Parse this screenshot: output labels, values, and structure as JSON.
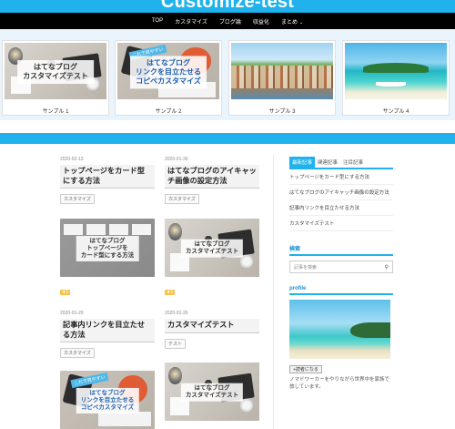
{
  "site": {
    "title": "Customize-test"
  },
  "nav": {
    "items": [
      "TOP",
      "カスタマイズ",
      "ブログ論",
      "収益化",
      "まとめ"
    ],
    "dropdown_caret": "⌄"
  },
  "carousel": {
    "slides": [
      {
        "caption": "サンプル 1",
        "overlay": [
          "はてなブログ",
          "カスタマイズテスト"
        ],
        "theme": "desk"
      },
      {
        "caption": "サンプル 2",
        "overlay": [
          "はてなブログ",
          "リンクを目立たせる",
          "コピペカスタマイズ"
        ],
        "theme": "desk2"
      },
      {
        "caption": "サンプル 3",
        "theme": "town"
      },
      {
        "caption": "サンプル 4",
        "theme": "beach"
      }
    ]
  },
  "posts": [
    {
      "date": "2020-02-13",
      "title": "トップページをカード型にする方法",
      "tag": "カスタマイズ",
      "thumb_text": [
        "はてなブログ",
        "トップページを",
        "カード型にする方法"
      ]
    },
    {
      "date": "2020-01-30",
      "title": "はてなブログのアイキャッチ画像の設定方法",
      "tag": "カスタマイズ",
      "thumb_text": [
        "はてなブログ",
        "カスタマイズテスト"
      ]
    },
    {
      "date": "2020-01-29",
      "title": "記事内リンクを目立たせる方法",
      "tag": "カスタマイズ",
      "thumb_text": [
        "はてなブログ",
        "リンクを目立たせる",
        "コピペカスタマイズ"
      ]
    },
    {
      "date": "2020-01-26",
      "title": "カスタマイズテスト",
      "tag": "テスト",
      "thumb_text": [
        "はてなブログ",
        "カスタマイズテスト"
      ]
    }
  ],
  "badges": {
    "star": "★1"
  },
  "sticky_note": "これで見やすい",
  "sidebar": {
    "tabs": [
      "最新記事",
      "関連記事",
      "注目記事"
    ],
    "latest": [
      "トップページをカード型にする方法",
      "はてなブログのアイキャッチ画像の設定方法",
      "記事内リンクを目立たせる方法",
      "カスタマイズテスト"
    ],
    "search": {
      "heading": "検索",
      "placeholder": "記事を検索"
    },
    "profile": {
      "heading": "profile",
      "follow_label": "読者になる",
      "description": "ノマドワーカーをやりながら世界中を家族で旅しています。"
    }
  },
  "colors": {
    "accent": "#1fb2ec",
    "nav_bg": "#000000",
    "carousel_bg": "#e9f4fd"
  }
}
